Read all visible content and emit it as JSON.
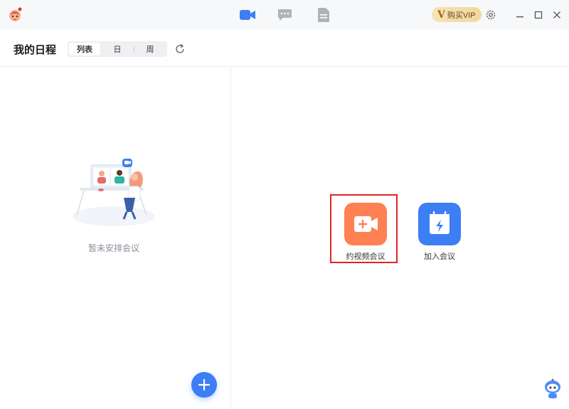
{
  "topbar": {
    "vip_v": "V",
    "vip_label": "购买VIP",
    "icons": [
      "video-meeting-tab-icon",
      "chat-tab-icon",
      "document-tab-icon",
      "settings-icon",
      "minimize-icon",
      "maximize-icon",
      "close-icon"
    ],
    "accent": "#3d7ef5"
  },
  "header": {
    "title": "我的日程",
    "view_modes": [
      "列表",
      "日",
      "周"
    ],
    "active_mode": "列表"
  },
  "left_panel": {
    "empty_text": "暂未安排会议"
  },
  "right_panel": {
    "actions": [
      {
        "label": "约视频会议",
        "color": "#ff8050"
      },
      {
        "label": "加入会议",
        "color": "#3d7ef5"
      }
    ],
    "highlight_color": "#e02424"
  }
}
